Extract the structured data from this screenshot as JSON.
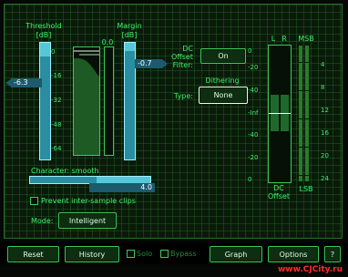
{
  "threshold": {
    "title": "Threshold",
    "unit": "[dB]",
    "value_label": "-6.3",
    "level_fraction": 0.88
  },
  "margin": {
    "title": "Margin",
    "unit": "[dB]",
    "value_label": "-0.7",
    "level_fraction": 0.93,
    "peak": "0.0"
  },
  "reduction_scale": [
    "0",
    "-16",
    "-32",
    "-48",
    "-64"
  ],
  "dc_offset_filter": {
    "label_l1": "DC",
    "label_l2": "Offset",
    "label_l3": "Filter:",
    "value": "On"
  },
  "dithering": {
    "title": "Dithering",
    "type_label": "Type:",
    "value": "None"
  },
  "output_meter": {
    "channels": [
      "L",
      "R"
    ],
    "scale": [
      "0",
      "-20",
      "-40",
      "-Inf",
      "-40",
      "-20",
      "0"
    ],
    "footer_l1": "DC",
    "footer_l2": "Offset"
  },
  "bits": {
    "header": "MSB",
    "footer": "LSB",
    "labels": [
      "4",
      "8",
      "12",
      "16",
      "20",
      "24"
    ]
  },
  "character": {
    "label": "Character: smooth",
    "value": "4.0",
    "fraction": 0.55
  },
  "prevent_clips": {
    "label": "Prevent inter-sample clips",
    "checked": false
  },
  "mode": {
    "label": "Mode:",
    "value": "Intelligent"
  },
  "toolbar": {
    "reset": "Reset",
    "history": "History",
    "solo": "Solo",
    "bypass": "Bypass",
    "graph": "Graph",
    "options": "Options",
    "help": "?"
  },
  "watermark": "www.CJCity.ru",
  "colors": {
    "accent": "#3cf06a",
    "slider": "#55c8d8",
    "watermark": "#ff2b2b"
  }
}
